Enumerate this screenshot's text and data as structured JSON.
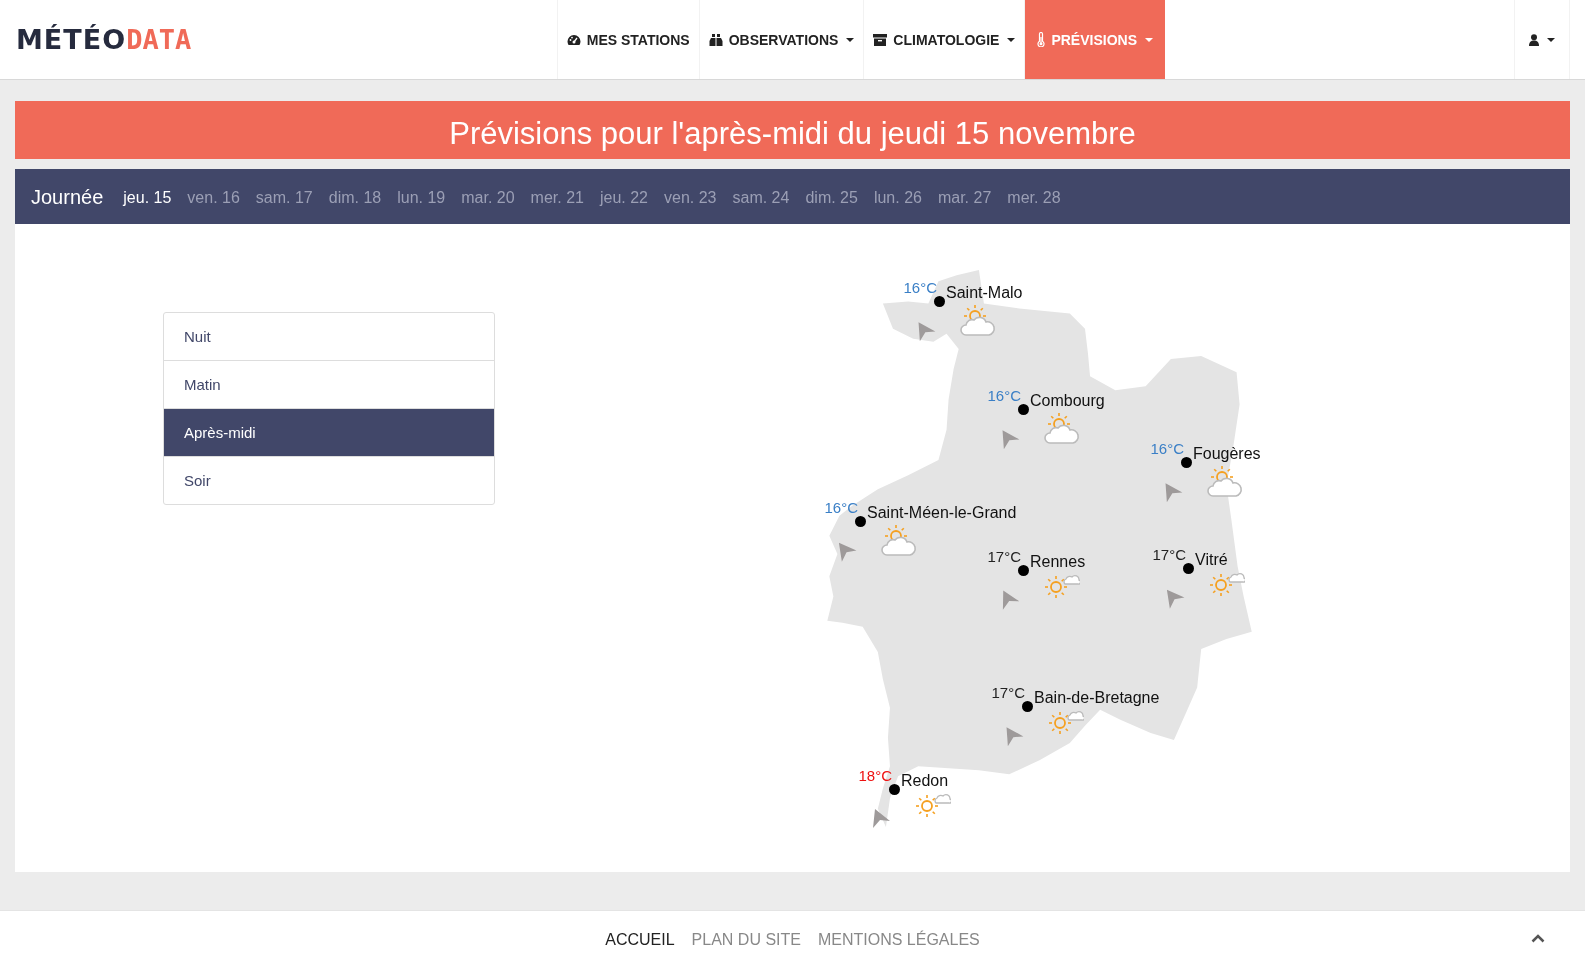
{
  "logo": {
    "part_1": "MÉTÉO",
    "part_2": "DATA"
  },
  "nav": [
    {
      "label": "MES STATIONS",
      "dropdown": false,
      "selected": false
    },
    {
      "label": "OBSERVATIONS",
      "dropdown": true,
      "selected": false
    },
    {
      "label": "CLIMATOLOGIE",
      "dropdown": true,
      "selected": false
    },
    {
      "label": "PRÉVISIONS",
      "dropdown": true,
      "selected": true
    }
  ],
  "banner": {
    "title": "Prévisions pour l'après-midi du jeudi 15 novembre"
  },
  "day_bar": {
    "label": "Journée",
    "days": [
      {
        "label": "jeu. 15",
        "selected": true
      },
      {
        "label": "ven. 16",
        "selected": false
      },
      {
        "label": "sam. 17",
        "selected": false
      },
      {
        "label": "dim. 18",
        "selected": false
      },
      {
        "label": "lun. 19",
        "selected": false
      },
      {
        "label": "mar. 20",
        "selected": false
      },
      {
        "label": "mer. 21",
        "selected": false
      },
      {
        "label": "jeu. 22",
        "selected": false
      },
      {
        "label": "ven. 23",
        "selected": false
      },
      {
        "label": "sam. 24",
        "selected": false
      },
      {
        "label": "dim. 25",
        "selected": false
      },
      {
        "label": "lun. 26",
        "selected": false
      },
      {
        "label": "mar. 27",
        "selected": false
      },
      {
        "label": "mer. 28",
        "selected": false
      }
    ]
  },
  "periods": [
    {
      "label": "Nuit",
      "selected": false
    },
    {
      "label": "Matin",
      "selected": false
    },
    {
      "label": "Après-midi",
      "selected": true
    },
    {
      "label": "Soir",
      "selected": false
    }
  ],
  "stations": [
    {
      "name": "Saint-Malo",
      "temperature": "16°C",
      "color": "#3a7fc6",
      "kind": "cloudy"
    },
    {
      "name": "Combourg",
      "temperature": "16°C",
      "color": "#3a7fc6",
      "kind": "cloudy"
    },
    {
      "name": "Fougères",
      "temperature": "16°C",
      "color": "#3a7fc6",
      "kind": "cloudy"
    },
    {
      "name": "Saint-Méen-le-Grand",
      "temperature": "16°C",
      "color": "#3a7fc6",
      "kind": "cloudy"
    },
    {
      "name": "Rennes",
      "temperature": "17°C",
      "color": "#222222",
      "kind": "sunny"
    },
    {
      "name": "Vitré",
      "temperature": "17°C",
      "color": "#222222",
      "kind": "sunny"
    },
    {
      "name": "Bain-de-Bretagne",
      "temperature": "17°C",
      "color": "#222222",
      "kind": "sunny"
    },
    {
      "name": "Redon",
      "temperature": "18°C",
      "color": "#ee1111",
      "kind": "sunny"
    }
  ],
  "footer": {
    "links": [
      {
        "label": "ACCUEIL",
        "selected": true
      },
      {
        "label": "PLAN DU SITE",
        "selected": false
      },
      {
        "label": "MENTIONS LÉGALES",
        "selected": false
      }
    ]
  }
}
